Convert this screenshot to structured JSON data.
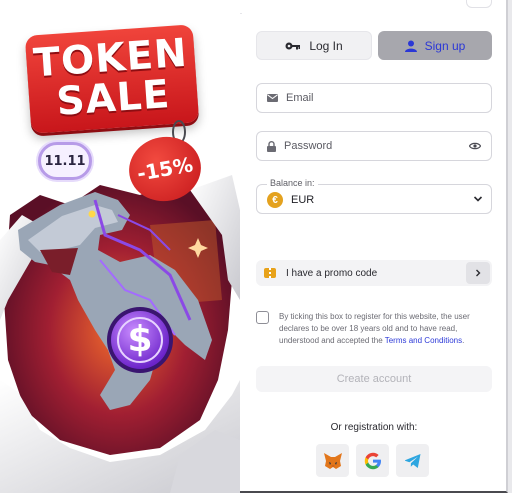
{
  "promo": {
    "headline_line1": "TOKEN",
    "headline_line2": "SALE",
    "date_badge": "11.11",
    "discount": "-15%",
    "coin_symbol": "$"
  },
  "tabs": {
    "login_label": "Log In",
    "signup_label": "Sign up",
    "active": "signup"
  },
  "form": {
    "email_placeholder": "Email",
    "password_placeholder": "Password",
    "balance_caption": "Balance in:",
    "currency_symbol": "€",
    "currency_value": "EUR",
    "promo_label": "I have a promo code",
    "terms_text": "By ticking this box to register for this website, the user declares to be over 18 years old and to have read, understood and accepted the ",
    "terms_link": "Terms and Conditions",
    "terms_end": ".",
    "create_account_label": "Create account",
    "or_registration": "Or registration with:"
  },
  "social": [
    "metamask-icon",
    "google-icon",
    "telegram-icon"
  ],
  "colors": {
    "accent_blue": "#2b37d6",
    "promo_red": "#d71f22",
    "purple": "#8b49e6",
    "coin_gold": "#e4a21f"
  }
}
